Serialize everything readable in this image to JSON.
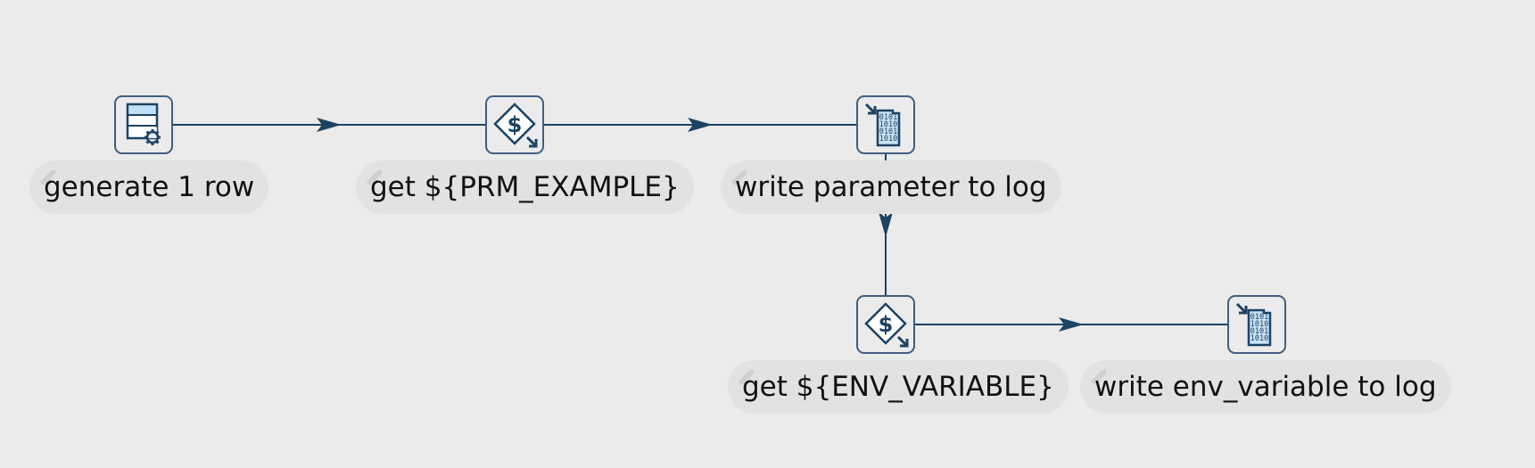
{
  "canvas": {
    "background": "#ebebeb",
    "edge_color": "#1d4262",
    "node_border_color": "#3f5f7f"
  },
  "nodes": [
    {
      "id": "n1",
      "icon": "row-generator-icon",
      "label": "generate 1 row"
    },
    {
      "id": "n2",
      "icon": "get-variable-icon",
      "label": "get ${PRM_EXAMPLE}"
    },
    {
      "id": "n3",
      "icon": "write-to-log-icon",
      "label": "write parameter to log"
    },
    {
      "id": "n4",
      "icon": "get-variable-icon",
      "label": "get ${ENV_VARIABLE}"
    },
    {
      "id": "n5",
      "icon": "write-to-log-icon",
      "label": "write env_variable to log"
    }
  ],
  "edges": [
    {
      "from": "n1",
      "to": "n2"
    },
    {
      "from": "n2",
      "to": "n3"
    },
    {
      "from": "n3",
      "to": "n4"
    },
    {
      "from": "n4",
      "to": "n5"
    }
  ]
}
